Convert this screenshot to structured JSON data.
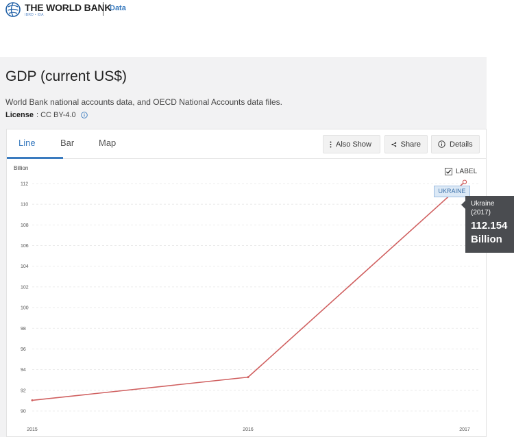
{
  "header": {
    "logo_title": "THE WORLD BANK",
    "logo_subtitle": "IBRD • IDA",
    "data_link": "Data"
  },
  "indicator": {
    "title": "GDP (current US$)",
    "source": "World Bank national accounts data, and OECD National Accounts data files.",
    "license_label": "License",
    "license_value": ": CC BY-4.0"
  },
  "tabs": [
    {
      "label": "Line",
      "active": true
    },
    {
      "label": "Bar",
      "active": false
    },
    {
      "label": "Map",
      "active": false
    }
  ],
  "toolbar": {
    "also_show": "Also Show",
    "share": "Share",
    "details": "Details"
  },
  "label_toggle": {
    "label": "LABEL",
    "checked": true
  },
  "series_tag": "UKRAINE",
  "tooltip": {
    "country": "Ukraine",
    "year": "(2017)",
    "value": "112.154",
    "unit": "Billion"
  },
  "colors": {
    "accent": "#3a7bbf",
    "line": "#d06060",
    "panel": "#f2f2f3",
    "tooltip_bg": "#4a4c50"
  },
  "chart_data": {
    "type": "line",
    "ylabel": "Billion",
    "x": [
      "2015",
      "2016",
      "2017"
    ],
    "series": [
      {
        "name": "UKRAINE",
        "values": [
          91.03,
          93.27,
          112.154
        ]
      }
    ],
    "yticks": [
      "90",
      "92",
      "94",
      "96",
      "98",
      "100",
      "102",
      "104",
      "106",
      "108",
      "110",
      "112"
    ],
    "ylim": [
      90,
      112
    ],
    "grid": true
  }
}
